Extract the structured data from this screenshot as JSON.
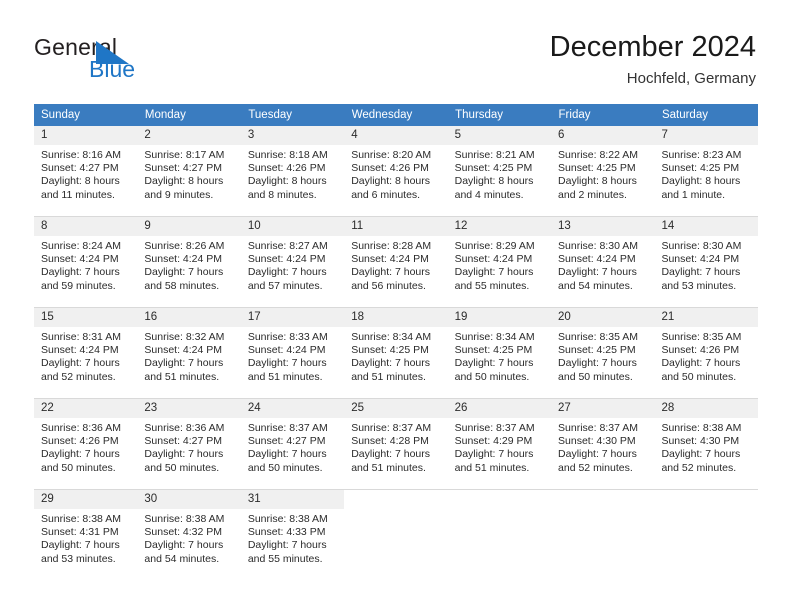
{
  "brand": {
    "name_part1": "General",
    "name_part2": "Blue",
    "mark": "triangle-flag-icon",
    "accent_color": "#1f76c6"
  },
  "header": {
    "title": "December 2024",
    "subtitle": "Hochfeld, Germany"
  },
  "theme": {
    "header_row_bg": "#3a7cc0",
    "daynum_bg": "#f0f0f0",
    "grid_line": "#d9d9d9",
    "text": "#2b2b2b"
  },
  "weekday_headers": [
    "Sunday",
    "Monday",
    "Tuesday",
    "Wednesday",
    "Thursday",
    "Friday",
    "Saturday"
  ],
  "weeks": [
    [
      {
        "day": "1",
        "sunrise": "Sunrise: 8:16 AM",
        "sunset": "Sunset: 4:27 PM",
        "daylight_1": "Daylight: 8 hours",
        "daylight_2": "and 11 minutes."
      },
      {
        "day": "2",
        "sunrise": "Sunrise: 8:17 AM",
        "sunset": "Sunset: 4:27 PM",
        "daylight_1": "Daylight: 8 hours",
        "daylight_2": "and 9 minutes."
      },
      {
        "day": "3",
        "sunrise": "Sunrise: 8:18 AM",
        "sunset": "Sunset: 4:26 PM",
        "daylight_1": "Daylight: 8 hours",
        "daylight_2": "and 8 minutes."
      },
      {
        "day": "4",
        "sunrise": "Sunrise: 8:20 AM",
        "sunset": "Sunset: 4:26 PM",
        "daylight_1": "Daylight: 8 hours",
        "daylight_2": "and 6 minutes."
      },
      {
        "day": "5",
        "sunrise": "Sunrise: 8:21 AM",
        "sunset": "Sunset: 4:25 PM",
        "daylight_1": "Daylight: 8 hours",
        "daylight_2": "and 4 minutes."
      },
      {
        "day": "6",
        "sunrise": "Sunrise: 8:22 AM",
        "sunset": "Sunset: 4:25 PM",
        "daylight_1": "Daylight: 8 hours",
        "daylight_2": "and 2 minutes."
      },
      {
        "day": "7",
        "sunrise": "Sunrise: 8:23 AM",
        "sunset": "Sunset: 4:25 PM",
        "daylight_1": "Daylight: 8 hours",
        "daylight_2": "and 1 minute."
      }
    ],
    [
      {
        "day": "8",
        "sunrise": "Sunrise: 8:24 AM",
        "sunset": "Sunset: 4:24 PM",
        "daylight_1": "Daylight: 7 hours",
        "daylight_2": "and 59 minutes."
      },
      {
        "day": "9",
        "sunrise": "Sunrise: 8:26 AM",
        "sunset": "Sunset: 4:24 PM",
        "daylight_1": "Daylight: 7 hours",
        "daylight_2": "and 58 minutes."
      },
      {
        "day": "10",
        "sunrise": "Sunrise: 8:27 AM",
        "sunset": "Sunset: 4:24 PM",
        "daylight_1": "Daylight: 7 hours",
        "daylight_2": "and 57 minutes."
      },
      {
        "day": "11",
        "sunrise": "Sunrise: 8:28 AM",
        "sunset": "Sunset: 4:24 PM",
        "daylight_1": "Daylight: 7 hours",
        "daylight_2": "and 56 minutes."
      },
      {
        "day": "12",
        "sunrise": "Sunrise: 8:29 AM",
        "sunset": "Sunset: 4:24 PM",
        "daylight_1": "Daylight: 7 hours",
        "daylight_2": "and 55 minutes."
      },
      {
        "day": "13",
        "sunrise": "Sunrise: 8:30 AM",
        "sunset": "Sunset: 4:24 PM",
        "daylight_1": "Daylight: 7 hours",
        "daylight_2": "and 54 minutes."
      },
      {
        "day": "14",
        "sunrise": "Sunrise: 8:30 AM",
        "sunset": "Sunset: 4:24 PM",
        "daylight_1": "Daylight: 7 hours",
        "daylight_2": "and 53 minutes."
      }
    ],
    [
      {
        "day": "15",
        "sunrise": "Sunrise: 8:31 AM",
        "sunset": "Sunset: 4:24 PM",
        "daylight_1": "Daylight: 7 hours",
        "daylight_2": "and 52 minutes."
      },
      {
        "day": "16",
        "sunrise": "Sunrise: 8:32 AM",
        "sunset": "Sunset: 4:24 PM",
        "daylight_1": "Daylight: 7 hours",
        "daylight_2": "and 51 minutes."
      },
      {
        "day": "17",
        "sunrise": "Sunrise: 8:33 AM",
        "sunset": "Sunset: 4:24 PM",
        "daylight_1": "Daylight: 7 hours",
        "daylight_2": "and 51 minutes."
      },
      {
        "day": "18",
        "sunrise": "Sunrise: 8:34 AM",
        "sunset": "Sunset: 4:25 PM",
        "daylight_1": "Daylight: 7 hours",
        "daylight_2": "and 51 minutes."
      },
      {
        "day": "19",
        "sunrise": "Sunrise: 8:34 AM",
        "sunset": "Sunset: 4:25 PM",
        "daylight_1": "Daylight: 7 hours",
        "daylight_2": "and 50 minutes."
      },
      {
        "day": "20",
        "sunrise": "Sunrise: 8:35 AM",
        "sunset": "Sunset: 4:25 PM",
        "daylight_1": "Daylight: 7 hours",
        "daylight_2": "and 50 minutes."
      },
      {
        "day": "21",
        "sunrise": "Sunrise: 8:35 AM",
        "sunset": "Sunset: 4:26 PM",
        "daylight_1": "Daylight: 7 hours",
        "daylight_2": "and 50 minutes."
      }
    ],
    [
      {
        "day": "22",
        "sunrise": "Sunrise: 8:36 AM",
        "sunset": "Sunset: 4:26 PM",
        "daylight_1": "Daylight: 7 hours",
        "daylight_2": "and 50 minutes."
      },
      {
        "day": "23",
        "sunrise": "Sunrise: 8:36 AM",
        "sunset": "Sunset: 4:27 PM",
        "daylight_1": "Daylight: 7 hours",
        "daylight_2": "and 50 minutes."
      },
      {
        "day": "24",
        "sunrise": "Sunrise: 8:37 AM",
        "sunset": "Sunset: 4:27 PM",
        "daylight_1": "Daylight: 7 hours",
        "daylight_2": "and 50 minutes."
      },
      {
        "day": "25",
        "sunrise": "Sunrise: 8:37 AM",
        "sunset": "Sunset: 4:28 PM",
        "daylight_1": "Daylight: 7 hours",
        "daylight_2": "and 51 minutes."
      },
      {
        "day": "26",
        "sunrise": "Sunrise: 8:37 AM",
        "sunset": "Sunset: 4:29 PM",
        "daylight_1": "Daylight: 7 hours",
        "daylight_2": "and 51 minutes."
      },
      {
        "day": "27",
        "sunrise": "Sunrise: 8:37 AM",
        "sunset": "Sunset: 4:30 PM",
        "daylight_1": "Daylight: 7 hours",
        "daylight_2": "and 52 minutes."
      },
      {
        "day": "28",
        "sunrise": "Sunrise: 8:38 AM",
        "sunset": "Sunset: 4:30 PM",
        "daylight_1": "Daylight: 7 hours",
        "daylight_2": "and 52 minutes."
      }
    ],
    [
      {
        "day": "29",
        "sunrise": "Sunrise: 8:38 AM",
        "sunset": "Sunset: 4:31 PM",
        "daylight_1": "Daylight: 7 hours",
        "daylight_2": "and 53 minutes."
      },
      {
        "day": "30",
        "sunrise": "Sunrise: 8:38 AM",
        "sunset": "Sunset: 4:32 PM",
        "daylight_1": "Daylight: 7 hours",
        "daylight_2": "and 54 minutes."
      },
      {
        "day": "31",
        "sunrise": "Sunrise: 8:38 AM",
        "sunset": "Sunset: 4:33 PM",
        "daylight_1": "Daylight: 7 hours",
        "daylight_2": "and 55 minutes."
      },
      {
        "day": "",
        "sunrise": "",
        "sunset": "",
        "daylight_1": "",
        "daylight_2": ""
      },
      {
        "day": "",
        "sunrise": "",
        "sunset": "",
        "daylight_1": "",
        "daylight_2": ""
      },
      {
        "day": "",
        "sunrise": "",
        "sunset": "",
        "daylight_1": "",
        "daylight_2": ""
      },
      {
        "day": "",
        "sunrise": "",
        "sunset": "",
        "daylight_1": "",
        "daylight_2": ""
      }
    ]
  ]
}
